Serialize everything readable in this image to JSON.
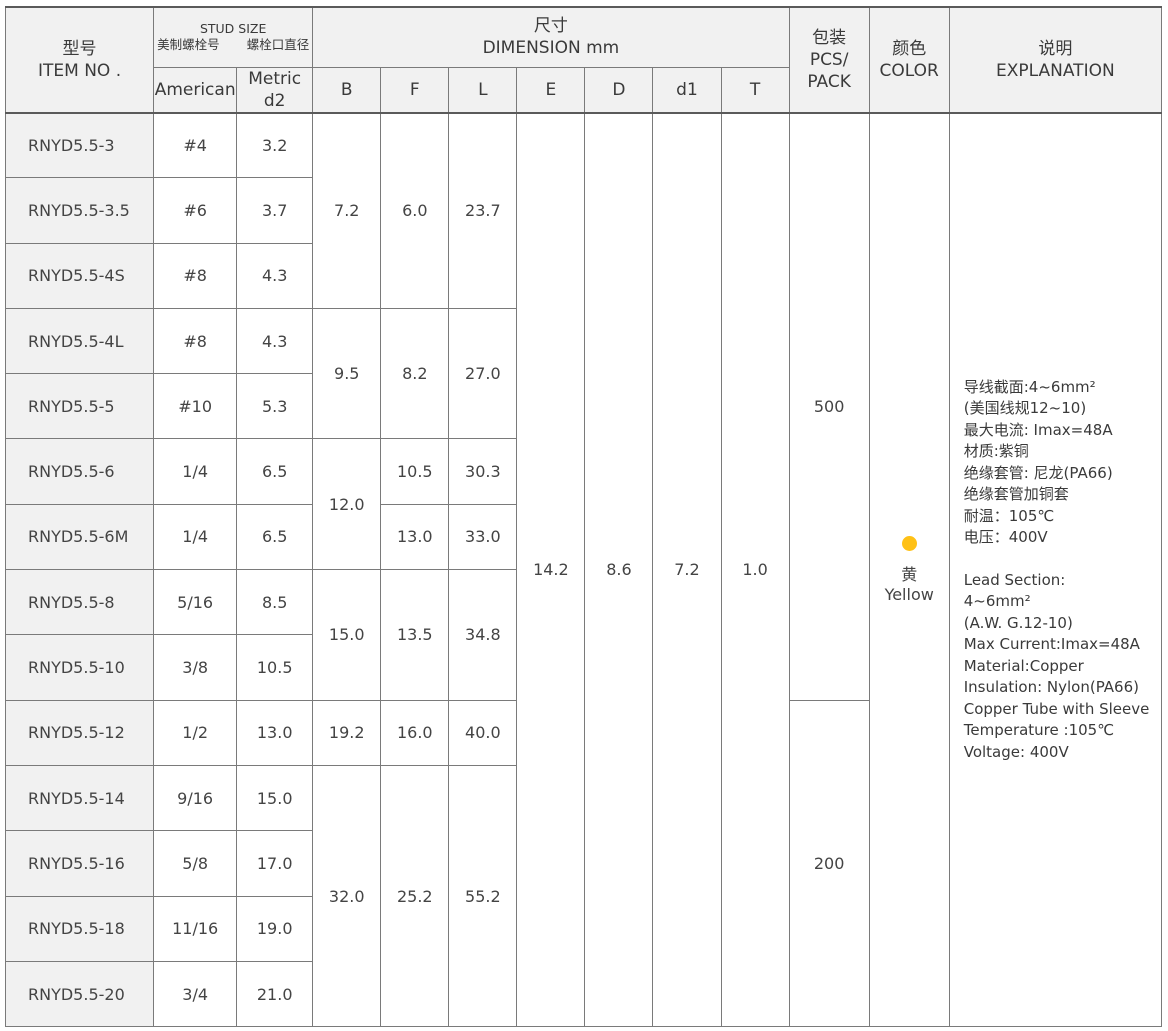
{
  "header": {
    "item_cn": "型号",
    "item_en": "ITEM NO .",
    "stud_title": "STUD SIZE",
    "stud_sub_american_cn": "美制螺栓号",
    "stud_sub_metric_cn": "螺栓口直径",
    "american": "American",
    "metric_line1": "Metric",
    "metric_line2": "d2",
    "dim_cn": "尺寸",
    "dim_en": "DIMENSION mm",
    "cols": [
      "B",
      "F",
      "L",
      "E",
      "D",
      "d1",
      "T"
    ],
    "pack_cn": "包装",
    "pack_en1": "PCS/",
    "pack_en2": "PACK",
    "color_cn": "颜色",
    "color_en": "COLOR",
    "expl_cn": "说明",
    "expl_en": "EXPLANATION"
  },
  "rows": [
    {
      "item": "RNYD5.5-3",
      "american": "#4",
      "metric": "3.2"
    },
    {
      "item": "RNYD5.5-3.5",
      "american": "#6",
      "metric": "3.7"
    },
    {
      "item": "RNYD5.5-4S",
      "american": "#8",
      "metric": "4.3"
    },
    {
      "item": "RNYD5.5-4L",
      "american": "#8",
      "metric": "4.3"
    },
    {
      "item": "RNYD5.5-5",
      "american": "#10",
      "metric": "5.3"
    },
    {
      "item": "RNYD5.5-6",
      "american": "1/4",
      "metric": "6.5"
    },
    {
      "item": "RNYD5.5-6M",
      "american": "1/4",
      "metric": "6.5"
    },
    {
      "item": "RNYD5.5-8",
      "american": "5/16",
      "metric": "8.5"
    },
    {
      "item": "RNYD5.5-10",
      "american": "3/8",
      "metric": "10.5"
    },
    {
      "item": "RNYD5.5-12",
      "american": "1/2",
      "metric": "13.0"
    },
    {
      "item": "RNYD5.5-14",
      "american": "9/16",
      "metric": "15.0"
    },
    {
      "item": "RNYD5.5-16",
      "american": "5/8",
      "metric": "17.0"
    },
    {
      "item": "RNYD5.5-18",
      "american": "11/16",
      "metric": "19.0"
    },
    {
      "item": "RNYD5.5-20",
      "american": "3/4",
      "metric": "21.0"
    }
  ],
  "merged": {
    "b": [
      "7.2",
      "9.5",
      "12.0",
      "15.0",
      "19.2",
      "32.0"
    ],
    "f": [
      "6.0",
      "8.2",
      "10.5",
      "13.0",
      "13.5",
      "16.0",
      "25.2"
    ],
    "l": [
      "23.7",
      "27.0",
      "30.3",
      "33.0",
      "34.8",
      "40.0",
      "55.2"
    ],
    "e": "14.2",
    "d": "8.6",
    "d1": "7.2",
    "t": "1.0",
    "pack": [
      "500",
      "200"
    ],
    "color_cn": "黄",
    "color_en": "Yellow",
    "color_hex": "#ffc116"
  },
  "explanation": {
    "cn": [
      "导线截面:4~6mm²",
      "(美国线规12~10)",
      "最大电流: Imax=48A",
      "材质:紫铜",
      "绝缘套管: 尼龙(PA66)",
      "绝缘套管加铜套",
      "耐温：105℃",
      "电压：400V"
    ],
    "en": [
      "Lead Section:",
      "4~6mm²",
      "(A.W. G.12-10)",
      "Max Current:Imax=48A",
      "Material:Copper",
      "Insulation: Nylon(PA66)",
      "Copper Tube with Sleeve",
      "Temperature :105℃",
      "Voltage: 400V"
    ]
  }
}
